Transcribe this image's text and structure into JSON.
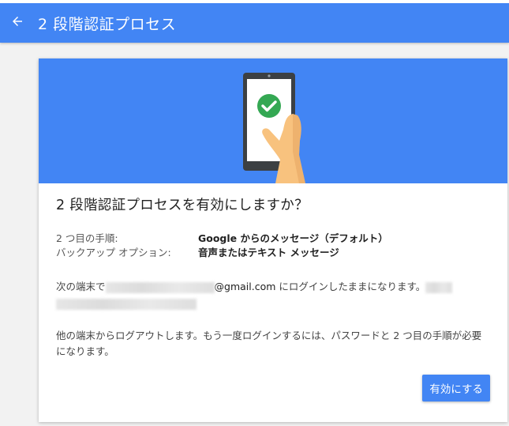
{
  "header": {
    "title": "2 段階認証プロセス",
    "back_icon": "arrow-back-icon"
  },
  "dialog": {
    "title": "2 段階認証プロセスを有効にしますか？",
    "info": [
      {
        "key": "2 つ目の手順:",
        "value": "Google からのメッセージ（デフォルト）"
      },
      {
        "key": "バックアップ オプション:",
        "value": "音声またはテキスト メッセージ"
      }
    ],
    "device_prefix": "次の端末で",
    "email_domain": "@gmail.com",
    "device_suffix": " にログインしたままになります。",
    "logout_notice": "他の端末からログアウトします。もう一度ログインするには、パスワードと 2 つ目の手順が必要になります。",
    "enable_label": "有効にする"
  },
  "colors": {
    "primary": "#4285f4",
    "success": "#34a853"
  },
  "icons": {
    "hero": "phone-check-icon"
  }
}
